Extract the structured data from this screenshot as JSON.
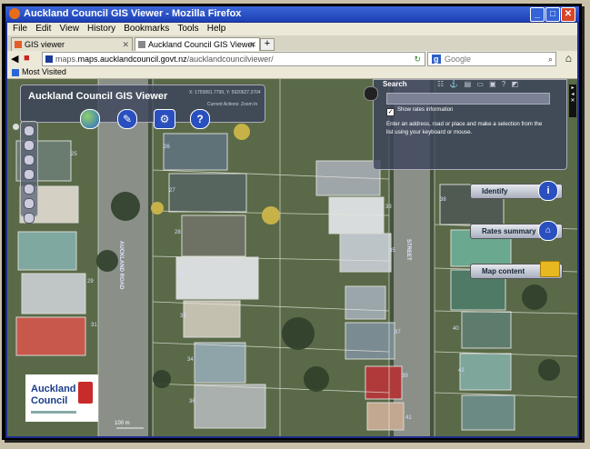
{
  "window": {
    "title": "Auckland Council GIS Viewer - Mozilla Firefox"
  },
  "menu": [
    "File",
    "Edit",
    "View",
    "History",
    "Bookmarks",
    "Tools",
    "Help"
  ],
  "tabs": [
    {
      "label": "GIS viewer"
    },
    {
      "label": "Auckland Council GIS Viewer"
    }
  ],
  "address": {
    "domain": "maps.aucklandcouncil.govt.nz",
    "path": "/aucklandcouncilviewer/",
    "prefix": "maps."
  },
  "search": {
    "placeholder": "Google"
  },
  "bookmarks": {
    "most_visited": "Most Visited"
  },
  "app": {
    "title": "Auckland Council GIS Viewer",
    "coords": "X: 1755891.7799, Y: 5920627.3704",
    "current_action": "Current Actions: Zoom In",
    "search_title": "Search",
    "rates_checkbox": "Show rates information",
    "instructions": "Enter an address, road or place and make a selection from the list using your keyboard or mouse.",
    "identify": "Identify",
    "rates_summary": "Rates summary",
    "map_content": "Map content"
  },
  "logo": {
    "line1": "Auckland",
    "line2": "Council"
  },
  "map": {
    "parcels": [
      "25",
      "26",
      "27",
      "28",
      "29",
      "30",
      "31",
      "32",
      "33",
      "34",
      "35",
      "36",
      "37",
      "38",
      "39",
      "40",
      "41",
      "42"
    ],
    "scale": "100 m"
  }
}
